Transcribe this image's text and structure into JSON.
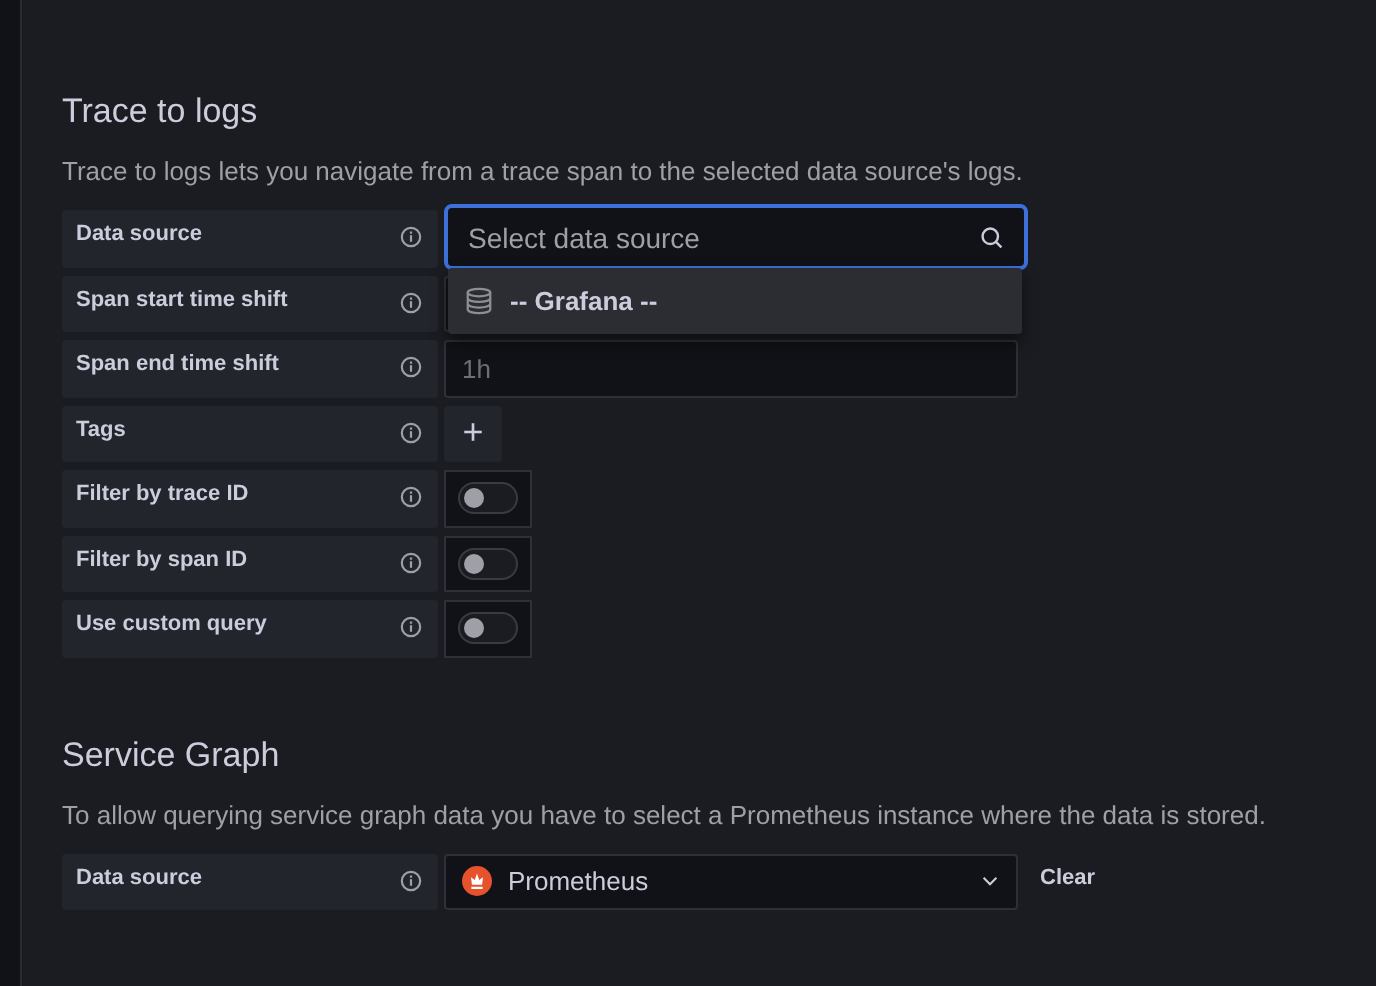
{
  "trace_to_logs": {
    "title": "Trace to logs",
    "description": "Trace to logs lets you navigate from a trace span to the selected data source's logs.",
    "fields": [
      {
        "label": "Data source",
        "kind": "select",
        "placeholder": "Select data source"
      },
      {
        "label": "Span start time shift",
        "kind": "input"
      },
      {
        "label": "Span end time shift",
        "kind": "input",
        "placeholder": "1h"
      },
      {
        "label": "Tags",
        "kind": "add",
        "symbol": "+"
      },
      {
        "label": "Filter by trace ID",
        "kind": "toggle",
        "on": false
      },
      {
        "label": "Filter by span ID",
        "kind": "toggle",
        "on": false
      },
      {
        "label": "Use custom query",
        "kind": "toggle",
        "on": false
      }
    ],
    "dropdown": {
      "options": [
        {
          "label": "-- Grafana --"
        }
      ]
    }
  },
  "service_graph": {
    "title": "Service Graph",
    "description": "To allow querying service graph data you have to select a Prometheus instance where the data is stored.",
    "data_source": {
      "label": "Data source",
      "value": "Prometheus",
      "clear": "Clear"
    }
  }
}
